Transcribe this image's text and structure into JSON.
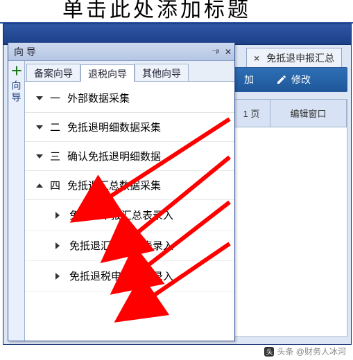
{
  "crop_heading": "单击此处添加标题",
  "main_tab": {
    "label": "免抵退申报汇总"
  },
  "toolbar": {
    "add_label": "加",
    "edit_label": "修改"
  },
  "grid": {
    "col1": "1 页",
    "col2": "编辑窗口"
  },
  "wizard": {
    "title": "向 导",
    "side_label": "向导",
    "tabs": [
      "备案向导",
      "退税向导",
      "其他向导"
    ],
    "active_tab": 1,
    "tree": [
      {
        "num": "一",
        "label": "外部数据采集",
        "expanded": false
      },
      {
        "num": "二",
        "label": "免抵退明细数据采集",
        "expanded": false
      },
      {
        "num": "三",
        "label": "确认免抵退明细数据",
        "expanded": false
      },
      {
        "num": "四",
        "label": "免抵退汇总数据采集",
        "expanded": true,
        "children": [
          "免抵退申报汇总表录入",
          "免抵退汇总表附表录入",
          "免抵退税申报资料录入"
        ]
      }
    ]
  },
  "watermark": "头条 @财务人冰河"
}
